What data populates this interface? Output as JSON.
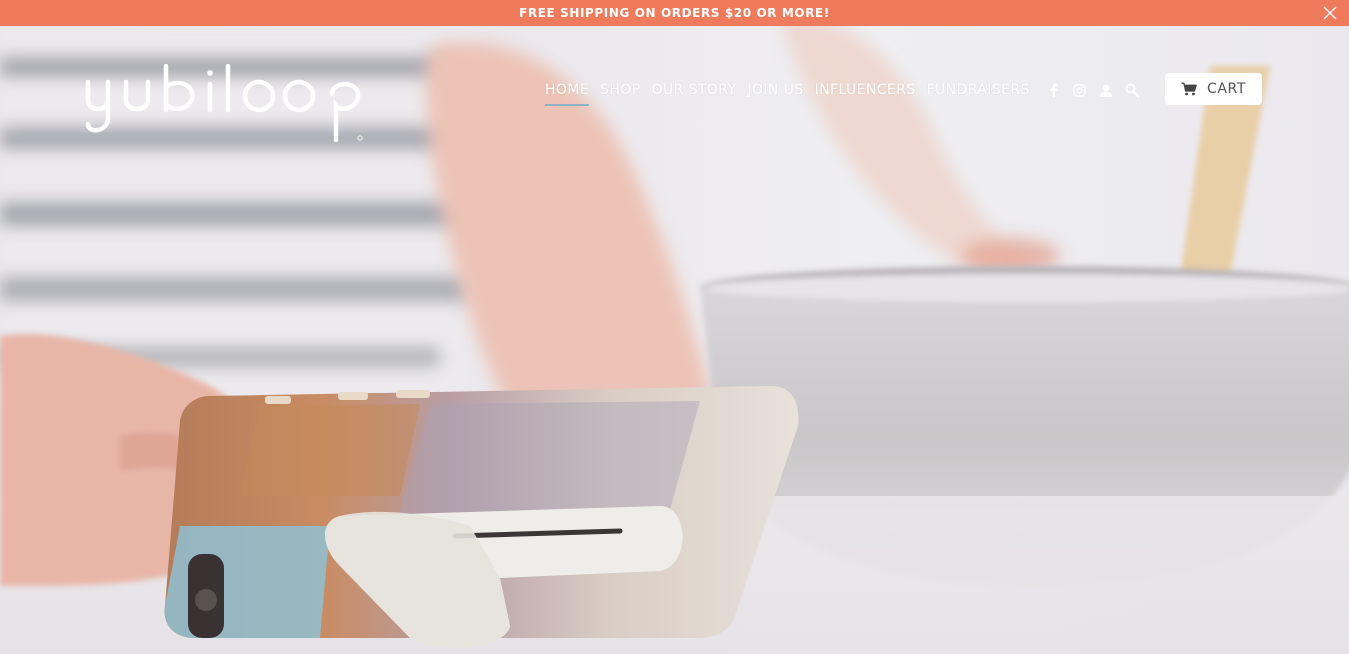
{
  "promo": {
    "text": "FREE SHIPPING ON ORDERS $20 OR MORE!"
  },
  "brand": {
    "logo_text": "yubiloop"
  },
  "nav": {
    "items": [
      {
        "label": "HOME",
        "active": true
      },
      {
        "label": "SHOP"
      },
      {
        "label": "OUR STORY"
      },
      {
        "label": "JOIN US"
      },
      {
        "label": "INFLUENCERS"
      },
      {
        "label": "FUNDRAISERS"
      }
    ],
    "icons": [
      "facebook-icon",
      "instagram-icon",
      "account-icon",
      "search-icon"
    ]
  },
  "cart": {
    "label": "CART",
    "icon": "cart-icon"
  },
  "colors": {
    "promo_bg": "#ef7a5c",
    "active_underline": "#8fb3c6",
    "text_light": "#ffffff"
  }
}
